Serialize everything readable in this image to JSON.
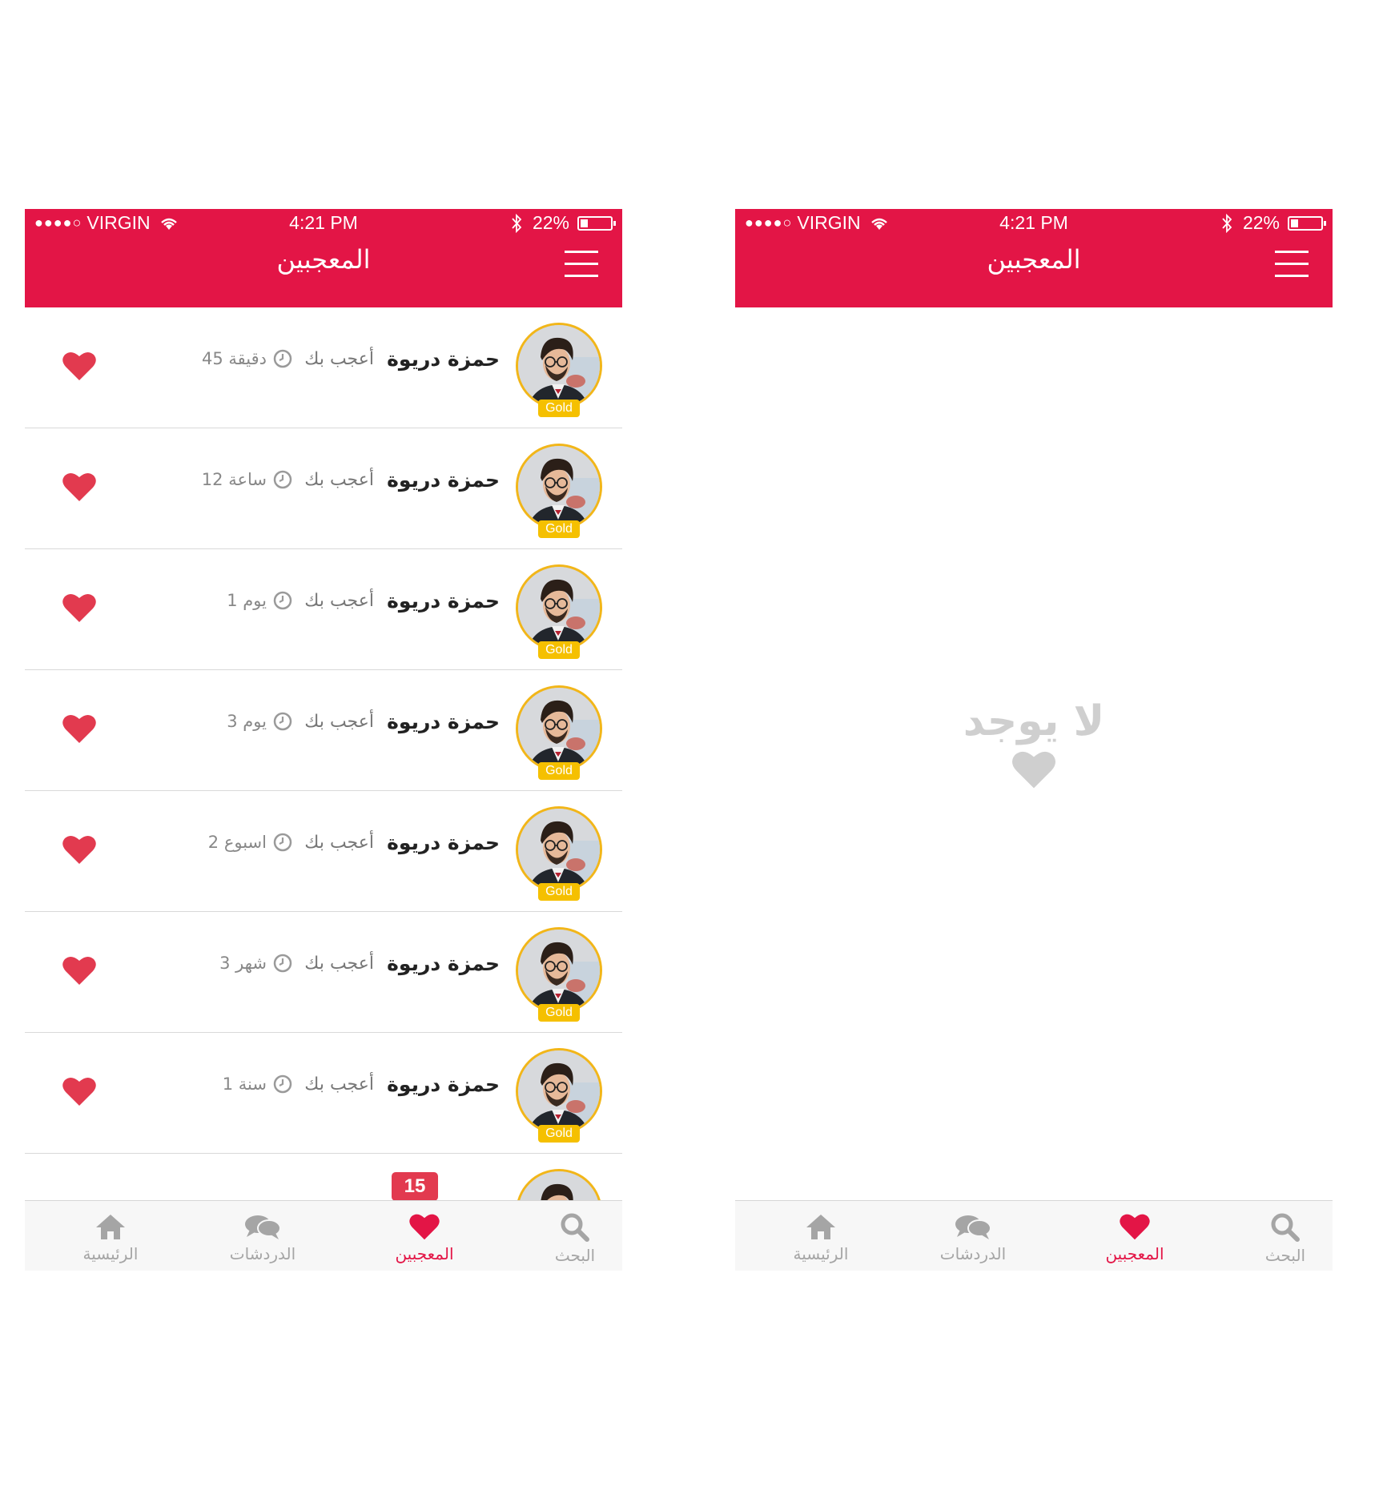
{
  "colors": {
    "brand": "#e31546",
    "gold": "#f5c000",
    "heart": "#e23a4f",
    "muted": "#a5a5a5",
    "empty": "#cfcfcf"
  },
  "status": {
    "carrier": "VIRGIN",
    "time": "4:21 PM",
    "battery": "22%",
    "battery_level": 0.22
  },
  "header": {
    "title": "المعجبين"
  },
  "likers": [
    {
      "name": "حمزة دريوة",
      "liked": "أعجب بك",
      "badge": "Gold",
      "time": "45 دقيقة"
    },
    {
      "name": "حمزة دريوة",
      "liked": "أعجب بك",
      "badge": "Gold",
      "time": "12 ساعة"
    },
    {
      "name": "حمزة دريوة",
      "liked": "أعجب بك",
      "badge": "Gold",
      "time": "1 يوم"
    },
    {
      "name": "حمزة دريوة",
      "liked": "أعجب بك",
      "badge": "Gold",
      "time": "3 يوم"
    },
    {
      "name": "حمزة دريوة",
      "liked": "أعجب بك",
      "badge": "Gold",
      "time": "2 اسبوع"
    },
    {
      "name": "حمزة دريوة",
      "liked": "أعجب بك",
      "badge": "Gold",
      "time": "3 شهر"
    },
    {
      "name": "حمزة دريوة",
      "liked": "أعجب بك",
      "badge": "Gold",
      "time": "1 سنة"
    }
  ],
  "tabs": {
    "home": "الرئيسية",
    "chats": "الدردشات",
    "likers": "المعجبين",
    "search": "البحث"
  },
  "likes_badge": "15",
  "empty_state": {
    "text": "لا يوجد"
  },
  "icons": [
    "menu-icon",
    "heart-icon",
    "clock-icon",
    "home-icon",
    "chat-icon",
    "search-icon",
    "wifi-icon",
    "bluetooth-icon",
    "battery-icon"
  ]
}
